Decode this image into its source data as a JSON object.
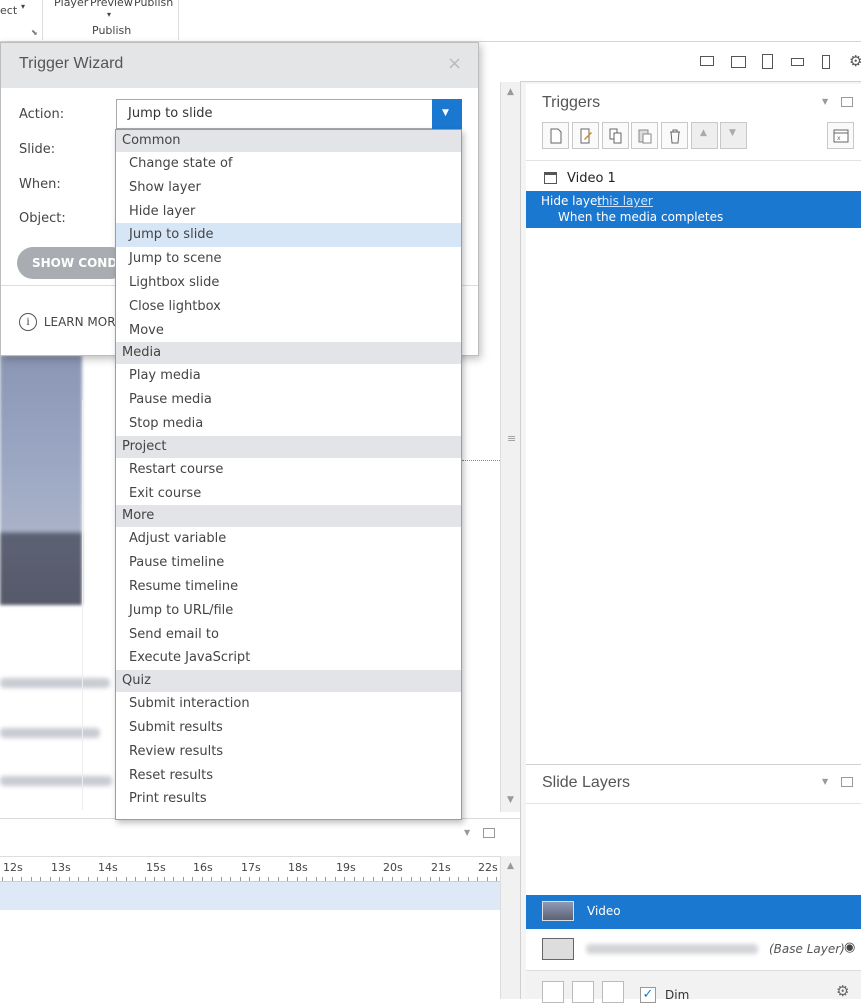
{
  "ribbon": {
    "select_fragment": "ect",
    "labels": [
      "Player",
      "Preview",
      "Publish"
    ],
    "group_label": "Publish"
  },
  "wizard": {
    "title": "Trigger Wizard",
    "close_glyph": "×",
    "action_label": "Action:",
    "slide_label": "Slide:",
    "when_label": "When:",
    "object_label": "Object:",
    "action_value": "Jump to slide",
    "show_conditions": "SHOW CONDITIONS",
    "learn_more": "LEARN MORE"
  },
  "dropdown": {
    "groups": [
      {
        "label": "Common",
        "items": [
          "Change state of",
          "Show layer",
          "Hide layer",
          "Jump to slide",
          "Jump to scene",
          "Lightbox slide",
          "Close lightbox",
          "Move"
        ]
      },
      {
        "label": "Media",
        "items": [
          "Play media",
          "Pause media",
          "Stop media"
        ]
      },
      {
        "label": "Project",
        "items": [
          "Restart course",
          "Exit course"
        ]
      },
      {
        "label": "More",
        "items": [
          "Adjust variable",
          "Pause timeline",
          "Resume timeline",
          "Jump to URL/file",
          "Send email to",
          "Execute JavaScript"
        ]
      },
      {
        "label": "Quiz",
        "items": [
          "Submit interaction",
          "Submit results",
          "Review results",
          "Reset results",
          "Print results"
        ]
      }
    ],
    "selected": "Jump to slide"
  },
  "timeline": {
    "ticks": [
      "12s",
      "13s",
      "14s",
      "15s",
      "16s",
      "17s",
      "18s",
      "19s",
      "20s",
      "21s",
      "22s"
    ]
  },
  "triggers": {
    "title": "Triggers",
    "object_name": "Video 1",
    "trigger_action": "Hide layer",
    "trigger_link": "this layer",
    "trigger_when": "When the media completes"
  },
  "layers": {
    "title": "Slide Layers",
    "video_layer": "Video",
    "base_layer_tag": "(Base Layer)",
    "dim_label": "Dim"
  },
  "colors": {
    "accent": "#1a78d0",
    "selected_item": "#d6e6f7",
    "group_bg": "#e2e4e7"
  }
}
